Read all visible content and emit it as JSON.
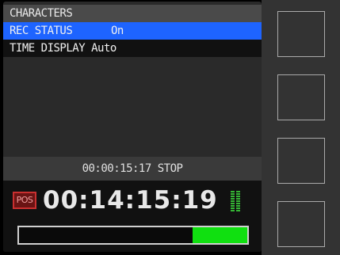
{
  "menu": {
    "title": "CHARACTERS",
    "items": [
      {
        "label": "REC STATUS",
        "value": "On",
        "selected": true
      },
      {
        "label": "TIME DISPLAY",
        "value": "Auto",
        "selected": false
      }
    ]
  },
  "status": {
    "text": "00:00:15:17 STOP"
  },
  "transport": {
    "pos_label": "POS",
    "timecode": "00:14:15:19",
    "progress_fraction": 0.24
  },
  "meter": {
    "level_fraction": 1.0
  },
  "soft_keys": [
    {
      "label": ""
    },
    {
      "label": ""
    },
    {
      "label": ""
    },
    {
      "label": ""
    }
  ],
  "colors": {
    "selection": "#1e64ff",
    "progress": "#10e010",
    "meter": "#35b635",
    "pos_badge": "#c93030"
  }
}
